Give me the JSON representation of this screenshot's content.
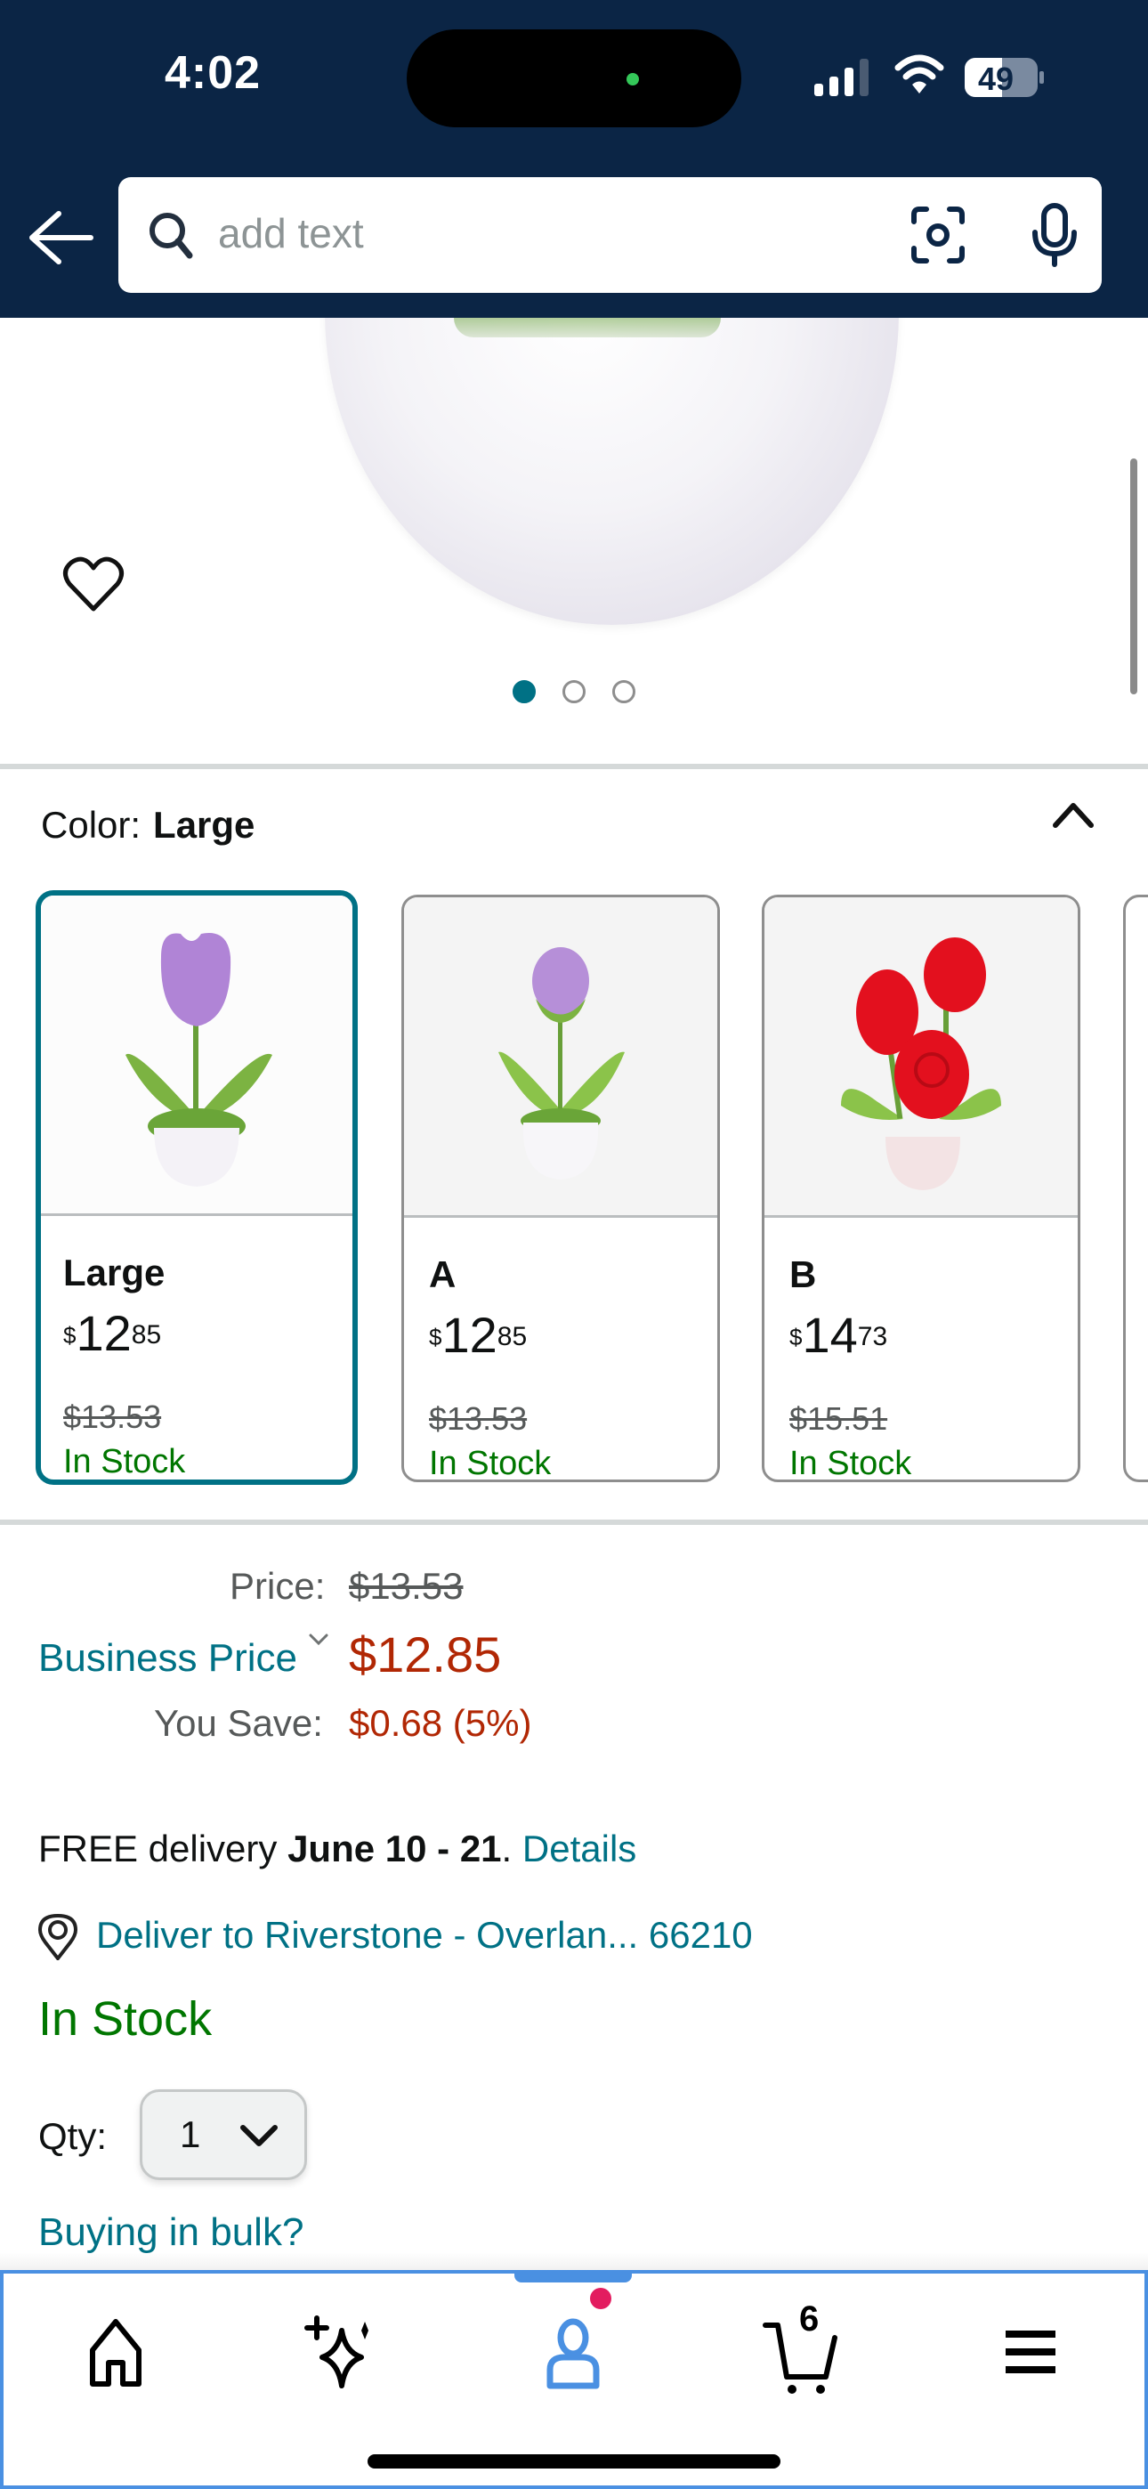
{
  "status_bar": {
    "time": "4:02",
    "battery_level": "49",
    "signal_bars_active": 3,
    "signal_bars_total": 4
  },
  "header": {
    "back_icon": "arrow-left-icon",
    "search": {
      "placeholder": "add text",
      "value": "",
      "left_icon": "search-icon",
      "lens_icon": "camera-lens-icon",
      "mic_icon": "microphone-icon"
    }
  },
  "hero": {
    "wishlist_icon": "heart-outline-icon",
    "image_count": 3,
    "active_image_index": 0
  },
  "variation": {
    "label": "Color:",
    "selected": "Large",
    "collapse_icon": "chevron-up-icon",
    "options": [
      {
        "name": "Large",
        "price_dollars": "12",
        "price_cents": "85",
        "currency": "$",
        "was_price": "$13.53",
        "stock": "In Stock",
        "selected": true,
        "flower": "purple tulip"
      },
      {
        "name": "A",
        "price_dollars": "12",
        "price_cents": "85",
        "currency": "$",
        "was_price": "$13.53",
        "stock": "In Stock",
        "selected": false,
        "flower": "purple bud"
      },
      {
        "name": "B",
        "price_dollars": "14",
        "price_cents": "73",
        "currency": "$",
        "was_price": "$15.51",
        "stock": "In Stock",
        "selected": false,
        "flower": "red roses"
      }
    ]
  },
  "pricing": {
    "price_label": "Price:",
    "list_price": "$13.53",
    "business_price_label": "Business Price",
    "business_price": "$12.85",
    "you_save_label": "You Save:",
    "you_save": "$0.68 (5%)"
  },
  "delivery": {
    "prefix": "FREE delivery ",
    "dates": "June 10 - 21",
    "suffix": ". ",
    "details_link": "Details",
    "deliver_to": "Deliver to Riverstone - Overlan... 66210",
    "stock_status": "In Stock"
  },
  "quantity": {
    "label": "Qty:",
    "value": "1"
  },
  "bulk_link": "Buying in bulk?",
  "bottom_nav": {
    "items": [
      {
        "name": "home",
        "icon": "home-icon"
      },
      {
        "name": "rufus",
        "icon": "sparkle-icon"
      },
      {
        "name": "account",
        "icon": "person-icon",
        "active": true,
        "has_notification": true
      },
      {
        "name": "cart",
        "icon": "cart-icon",
        "count": "6"
      },
      {
        "name": "menu",
        "icon": "hamburger-menu-icon"
      }
    ]
  },
  "colors": {
    "header_bg": "#0b2545",
    "link": "#007185",
    "price_red": "#b12704",
    "stock_green": "#007600",
    "active_nav": "#4a90e2",
    "notification": "#e31c5f"
  }
}
